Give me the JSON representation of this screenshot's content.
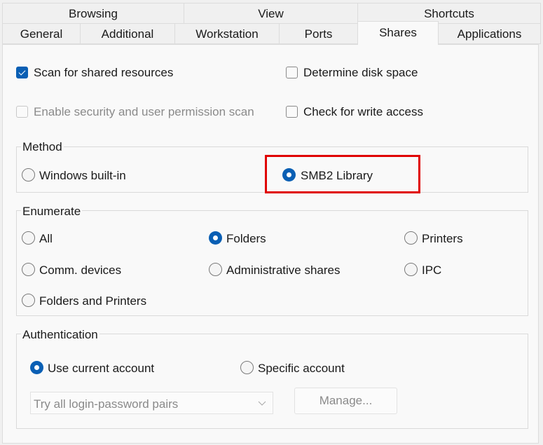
{
  "tabs": {
    "row1": [
      {
        "label": "Browsing"
      },
      {
        "label": "View"
      },
      {
        "label": "Shortcuts"
      }
    ],
    "row2": [
      {
        "label": "General"
      },
      {
        "label": "Additional"
      },
      {
        "label": "Workstation"
      },
      {
        "label": "Ports"
      },
      {
        "label": "Shares",
        "active": true
      },
      {
        "label": "Applications"
      }
    ]
  },
  "options": {
    "scan_shared": {
      "label": "Scan for shared resources",
      "checked": true,
      "enabled": true
    },
    "security_scan": {
      "label": "Enable security and user permission scan",
      "checked": false,
      "enabled": false
    },
    "disk_space": {
      "label": "Determine disk space",
      "checked": false,
      "enabled": true
    },
    "write_access": {
      "label": "Check for write access",
      "checked": false,
      "enabled": true
    }
  },
  "method": {
    "title": "Method",
    "options": [
      {
        "label": "Windows built-in",
        "selected": false
      },
      {
        "label": "SMB2 Library",
        "selected": true,
        "highlighted": true
      }
    ],
    "highlight_color": "#e00000"
  },
  "enumerate": {
    "title": "Enumerate",
    "options": [
      {
        "label": "All",
        "selected": false
      },
      {
        "label": "Folders",
        "selected": true
      },
      {
        "label": "Printers",
        "selected": false
      },
      {
        "label": "Comm. devices",
        "selected": false
      },
      {
        "label": "Administrative shares",
        "selected": false
      },
      {
        "label": "IPC",
        "selected": false
      },
      {
        "label": "Folders and Printers",
        "selected": false
      }
    ]
  },
  "authentication": {
    "title": "Authentication",
    "use_current": {
      "label": "Use current account",
      "selected": true
    },
    "specific": {
      "label": "Specific account",
      "selected": false
    },
    "combo_value": "Try all login-password pairs",
    "manage_label": "Manage..."
  },
  "colors": {
    "accent": "#0a5fb4",
    "highlight": "#e00000"
  }
}
